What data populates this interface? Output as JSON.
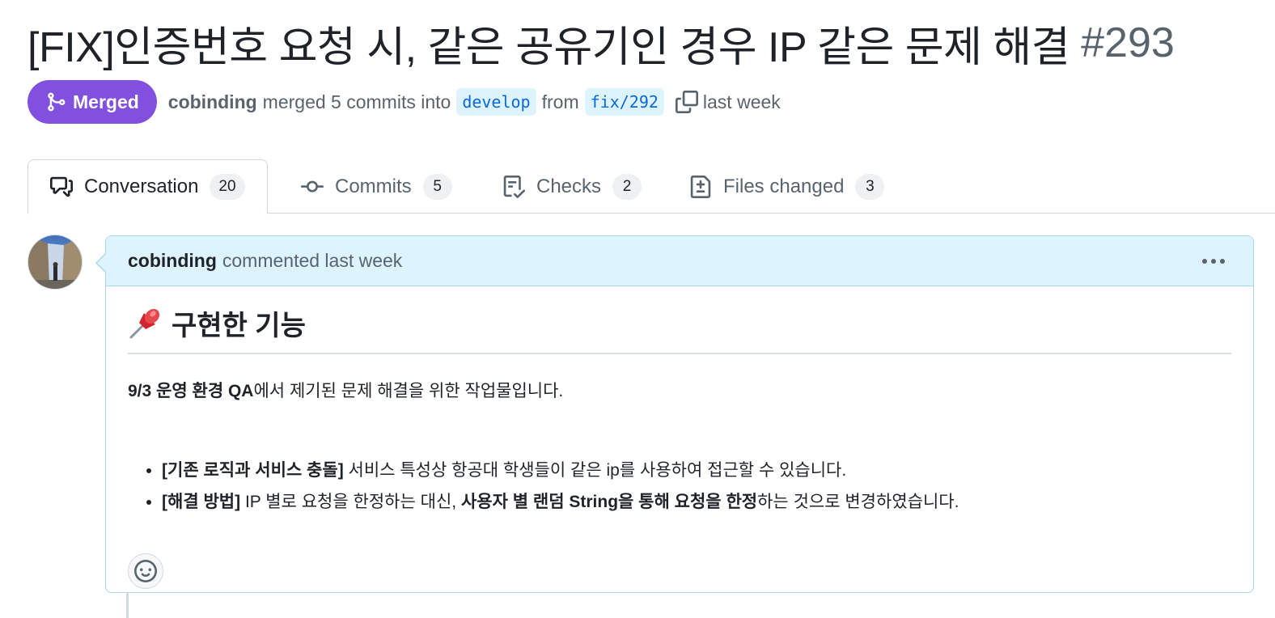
{
  "pr": {
    "title": "[FIX]인증번호 요청 시, 같은 공유기인 경우 IP 같은 문제 해결",
    "number": "#293",
    "status": "Merged",
    "author": "cobinding",
    "merge_text": "merged 5 commits into",
    "base_branch": "develop",
    "from_text": "from",
    "head_branch": "fix/292",
    "time": "last week"
  },
  "tabs": [
    {
      "label": "Conversation",
      "count": "20",
      "icon": "comment-discussion-icon"
    },
    {
      "label": "Commits",
      "count": "5",
      "icon": "git-commit-icon"
    },
    {
      "label": "Checks",
      "count": "2",
      "icon": "checklist-icon"
    },
    {
      "label": "Files changed",
      "count": "3",
      "icon": "file-diff-icon"
    }
  ],
  "comment": {
    "author": "cobinding",
    "action": "commented last week",
    "heading_text": "구현한 기능",
    "para_bold": "9/3 운영 환경 QA",
    "para_rest": "에서 제기된 문제 해결을 위한 작업물입니다.",
    "bullets": [
      {
        "bold": "[기존 로직과 서비스 충돌]",
        "text": " 서비스 특성상 항공대 학생들이 같은 ip를 사용하여 접근할 수 있습니다."
      },
      {
        "bold": "[해결 방법]",
        "text": " IP 별로 요청을 한정하는 대신, ",
        "bold2": "사용자 별 랜덤 String을 통해 요청을 한정",
        "text2": "하는 것으로 변경하였습니다."
      }
    ]
  },
  "colors": {
    "merged": "#8250df",
    "link": "#0969da",
    "comment_header_bg": "#ddf4ff"
  }
}
